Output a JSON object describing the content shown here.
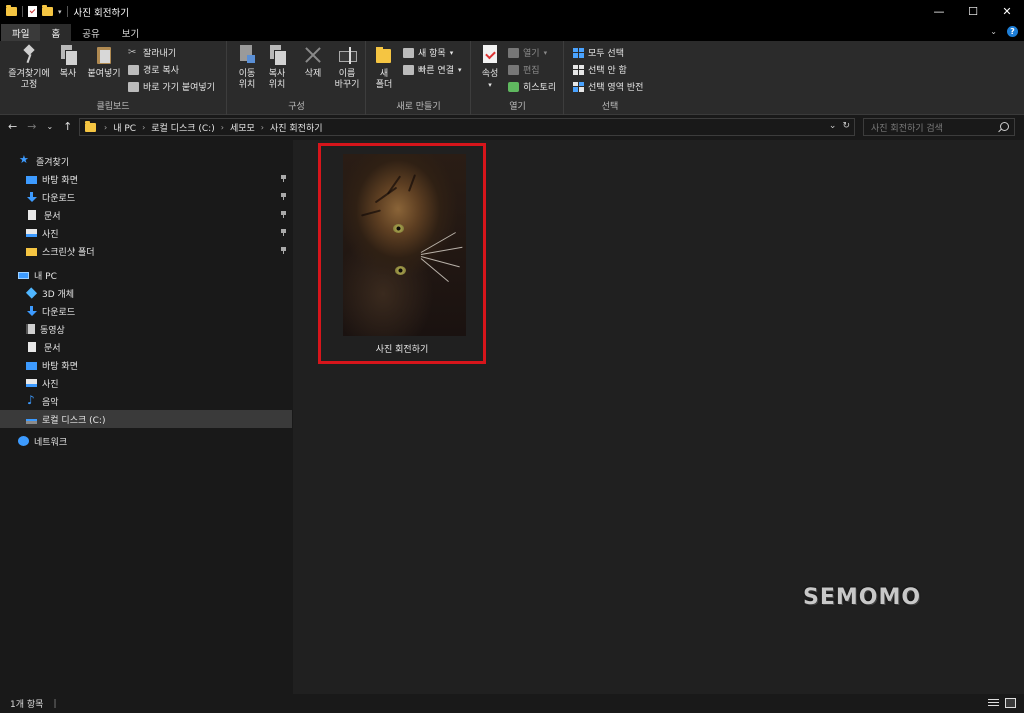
{
  "window": {
    "title": "사진 회전하기",
    "minimize": "—",
    "maximize": "☐",
    "close": "✕"
  },
  "tabs": [
    {
      "label": "파일"
    },
    {
      "label": "홈"
    },
    {
      "label": "공유"
    },
    {
      "label": "보기"
    }
  ],
  "ribbon": {
    "clipboard": {
      "label": "클립보드",
      "pin": "즐겨찾기에\n고정",
      "copy": "복사",
      "paste": "붙여넣기",
      "cut": "잘라내기",
      "copy_path": "경로 복사",
      "paste_shortcut": "바로 가기 붙여넣기"
    },
    "organize": {
      "label": "구성",
      "move_to": "이동\n위치",
      "copy_to": "복사\n위치",
      "delete": "삭제",
      "rename": "이름\n바꾸기"
    },
    "new": {
      "label": "새로 만들기",
      "new_folder": "새\n폴더",
      "new_item": "새 항목",
      "easy_access": "빠른 연결"
    },
    "open": {
      "label": "열기",
      "properties": "속성",
      "open": "열기",
      "edit": "편집",
      "history": "히스토리"
    },
    "select": {
      "label": "선택",
      "select_all": "모두 선택",
      "select_none": "선택 안 함",
      "invert": "선택 영역 반전"
    }
  },
  "address": {
    "breadcrumbs": [
      "내 PC",
      "로컬 디스크 (C:)",
      "세모모",
      "사진 회전하기"
    ],
    "search_placeholder": "사진 회전하기 검색"
  },
  "navpane": {
    "quick_access": "즐겨찾기",
    "quick_items": [
      "바탕 화면",
      "다운로드",
      "문서",
      "사진",
      "스크린샷 폴더"
    ],
    "this_pc": "내 PC",
    "pc_items": [
      "3D 개체",
      "다운로드",
      "동영상",
      "문서",
      "바탕 화면",
      "사진",
      "음악",
      "로컬 디스크 (C:)"
    ],
    "network": "네트워크",
    "selected": "로컬 디스크 (C:)"
  },
  "content": {
    "items": [
      {
        "name": "사진 회전하기",
        "type": "image"
      }
    ],
    "highlight_color": "#d7151b"
  },
  "watermark": "SEMOMO",
  "status": {
    "count": "1개 항목",
    "sep": "|"
  }
}
